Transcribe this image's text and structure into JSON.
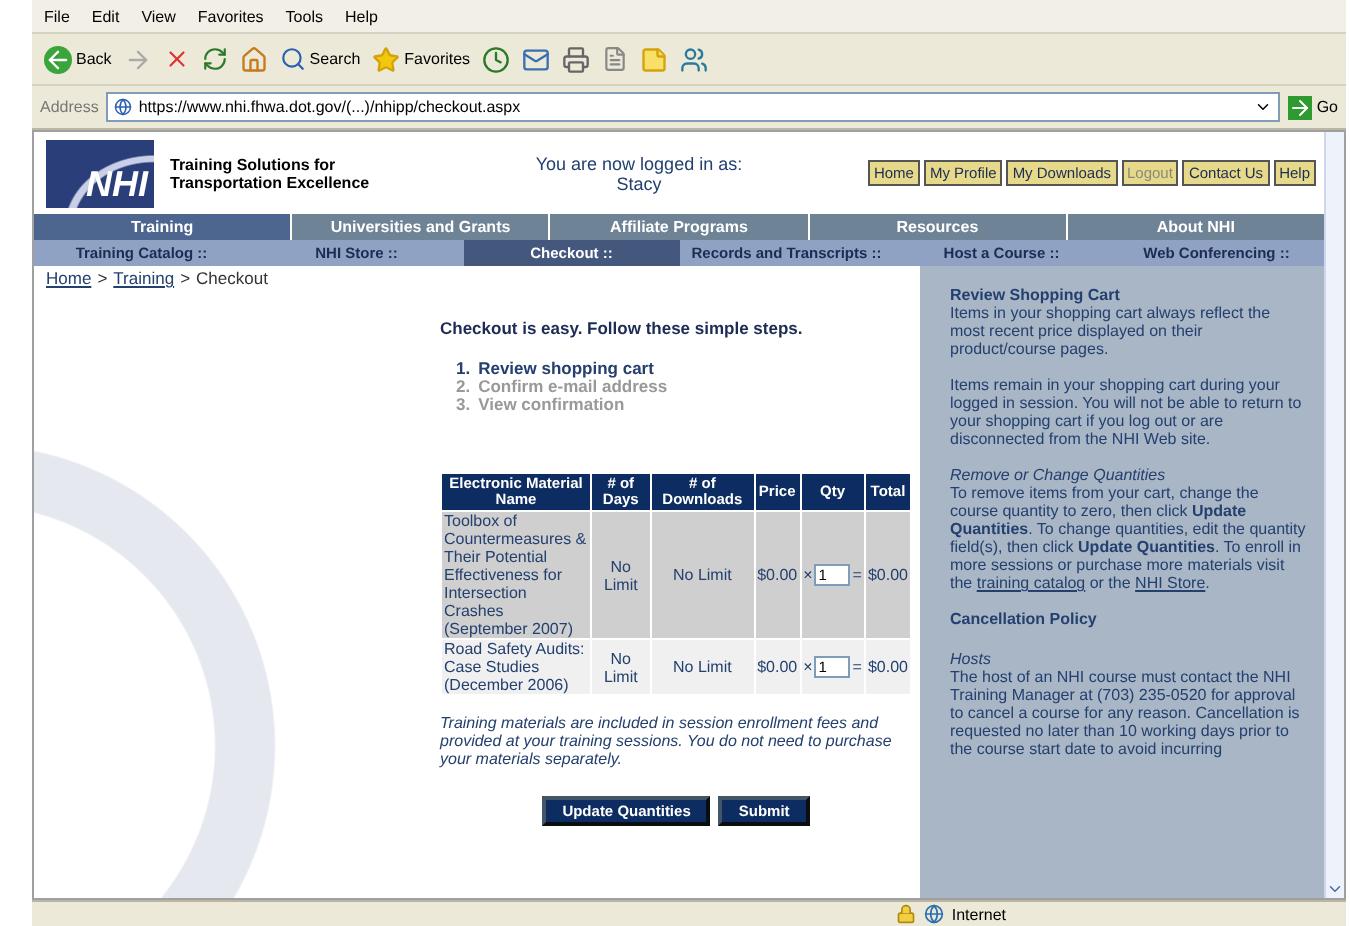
{
  "browser": {
    "menu": [
      "File",
      "Edit",
      "View",
      "Favorites",
      "Tools",
      "Help"
    ],
    "toolbar": {
      "back": "Back",
      "search": "Search",
      "favorites": "Favorites"
    },
    "address": {
      "label": "Address",
      "url": "https://www.nhi.fhwa.dot.gov/(...)/nhipp/checkout.aspx",
      "go": "Go"
    }
  },
  "header": {
    "logo": "NHI",
    "tagline": [
      "Training Solutions for",
      "Transportation Excellence"
    ],
    "login_text": "You are now logged in as:",
    "user": "Stacy",
    "buttons": [
      {
        "label": "Home",
        "disabled": false
      },
      {
        "label": "My Profile",
        "disabled": false
      },
      {
        "label": "My Downloads",
        "disabled": false
      },
      {
        "label": "Logout",
        "disabled": true
      },
      {
        "label": "Contact Us",
        "disabled": false
      },
      {
        "label": "Help",
        "disabled": false
      }
    ]
  },
  "nav_primary": [
    {
      "label": "Training",
      "selected": true
    },
    {
      "label": "Universities and Grants",
      "selected": false
    },
    {
      "label": "Affiliate Programs",
      "selected": false
    },
    {
      "label": "Resources",
      "selected": false
    },
    {
      "label": "About NHI",
      "selected": false
    }
  ],
  "nav_secondary": [
    {
      "label": "Training Catalog ::",
      "selected": false
    },
    {
      "label": "NHI Store ::",
      "selected": false
    },
    {
      "label": "Checkout ::",
      "selected": true
    },
    {
      "label": "Records and Transcripts ::",
      "selected": false
    },
    {
      "label": "Host a Course ::",
      "selected": false
    },
    {
      "label": "Web Conferencing ::",
      "selected": false
    }
  ],
  "breadcrumb": {
    "separator": ">",
    "items": [
      {
        "label": "Home",
        "kind": "link"
      },
      {
        "label": "Training",
        "kind": "link"
      },
      {
        "label": "Checkout",
        "kind": "current"
      }
    ]
  },
  "main": {
    "heading": "Checkout is easy. Follow these simple steps.",
    "steps": [
      {
        "number": "1.",
        "label": "Review shopping cart",
        "selected": true
      },
      {
        "number": "2.",
        "label": "Confirm e-mail address",
        "selected": false
      },
      {
        "number": "3.",
        "label": "View confirmation",
        "selected": false
      }
    ],
    "table": {
      "columns": [
        "Electronic Material Name",
        "# of Days",
        "# of Downloads",
        "Price",
        "Qty",
        "Total"
      ],
      "rows": [
        {
          "name": "Toolbox of Countermeasures & Their Potential Effectiveness for Intersection Crashes (September 2007)",
          "days": "No Limit",
          "downloads": "No Limit",
          "price": "$0.00",
          "times": "×",
          "qty": "1",
          "equals": "=",
          "total": "$0.00"
        },
        {
          "name": "Road Safety Audits: Case Studies (December 2006)",
          "days": "No Limit",
          "downloads": "No Limit",
          "price": "$0.00",
          "times": "×",
          "qty": "1",
          "equals": "=",
          "total": "$0.00"
        }
      ]
    },
    "note": "Training materials are included in session enrollment fees and provided at your training sessions. You do not need to purchase your materials separately.",
    "buttons": [
      "Update Quantities",
      "Submit"
    ]
  },
  "sidebar": [
    {
      "kind": "heading",
      "segments": [
        {
          "kind": "text",
          "text": "Review Shopping Cart"
        }
      ]
    },
    {
      "kind": "paragraph",
      "segments": [
        {
          "kind": "text",
          "text": "Items in your shopping cart always reflect the most recent price displayed on their product/course pages."
        }
      ]
    },
    {
      "kind": "paragraph",
      "segments": [
        {
          "kind": "text",
          "text": "Items remain in your shopping cart during your logged in session. You will not be able to return to your shopping cart if you log out or are disconnected from the NHI Web site."
        }
      ]
    },
    {
      "kind": "subheading",
      "segments": [
        {
          "kind": "text",
          "text": "Remove or Change Quantities"
        }
      ]
    },
    {
      "kind": "paragraph",
      "segments": [
        {
          "kind": "text",
          "text": "To remove items from your cart, change the course quantity to zero, then click **Update Quantities**. To change quantities, edit the quantity field(s), then click **Update Quantities**. To enroll in more sessions or purchase more materials visit the"
        },
        {
          "kind": "link",
          "text": "training catalog"
        },
        {
          "kind": "text",
          "text": "or the"
        },
        {
          "kind": "link",
          "text": "NHI Store"
        },
        {
          "kind": "text",
          "text": "."
        }
      ]
    },
    {
      "kind": "heading",
      "segments": [
        {
          "kind": "text",
          "text": "Cancellation Policy"
        }
      ]
    },
    {
      "kind": "subheading",
      "segments": [
        {
          "kind": "text",
          "text": "Hosts"
        }
      ]
    },
    {
      "kind": "paragraph",
      "segments": [
        {
          "kind": "text",
          "text": "The host of an NHI course must contact the NHI Training Manager at (703) 235-0520 for approval to cancel a course for any reason. Cancellation is requested no later than 10 working days prior to the course start date to avoid incurring"
        }
      ]
    }
  ],
  "status_bar": {
    "zone": "Internet"
  }
}
